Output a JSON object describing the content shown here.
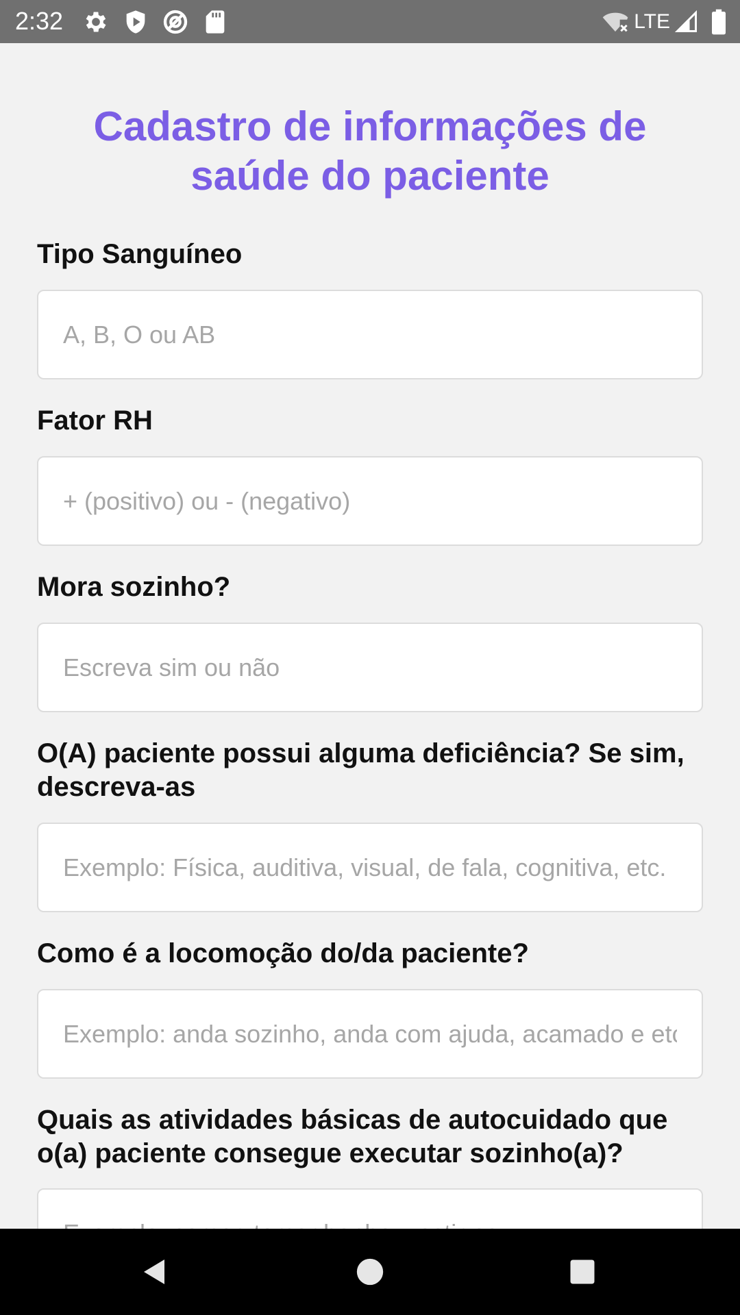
{
  "status_bar": {
    "time": "2:32",
    "network": "LTE",
    "icons": [
      "gear-icon",
      "shield-icon",
      "sync-icon",
      "sd-card-icon",
      "wifi-off-icon",
      "signal-icon",
      "battery-icon"
    ]
  },
  "title": "Cadastro de informações de saúde do paciente",
  "fields": [
    {
      "label": "Tipo Sanguíneo",
      "placeholder": "A, B, O ou AB",
      "value": ""
    },
    {
      "label": "Fator RH",
      "placeholder": "+ (positivo) ou - (negativo)",
      "value": ""
    },
    {
      "label": "Mora sozinho?",
      "placeholder": "Escreva sim ou não",
      "value": ""
    },
    {
      "label": "O(A) paciente possui alguma deficiência? Se sim, descreva-as",
      "placeholder": "Exemplo: Física, auditiva, visual, de fala, cognitiva, etc.",
      "value": ""
    },
    {
      "label": "Como é a locomoção do/da paciente?",
      "placeholder": "Exemplo: anda sozinho, anda com ajuda, acamado e etc",
      "value": ""
    },
    {
      "label": "Quais as atividades básicas de autocuidado que o(a) paciente consegue executar sozinho(a)?",
      "placeholder": "Exemplo: comer, tomar banho, vestir-se",
      "value": ""
    }
  ],
  "nav_bar": {
    "buttons": [
      "back-icon",
      "home-icon",
      "recents-icon"
    ]
  },
  "colors": {
    "accent": "#7b5ee5",
    "status_bar": "#707070",
    "background": "#f2f2f2",
    "nav_bar": "#000000"
  }
}
